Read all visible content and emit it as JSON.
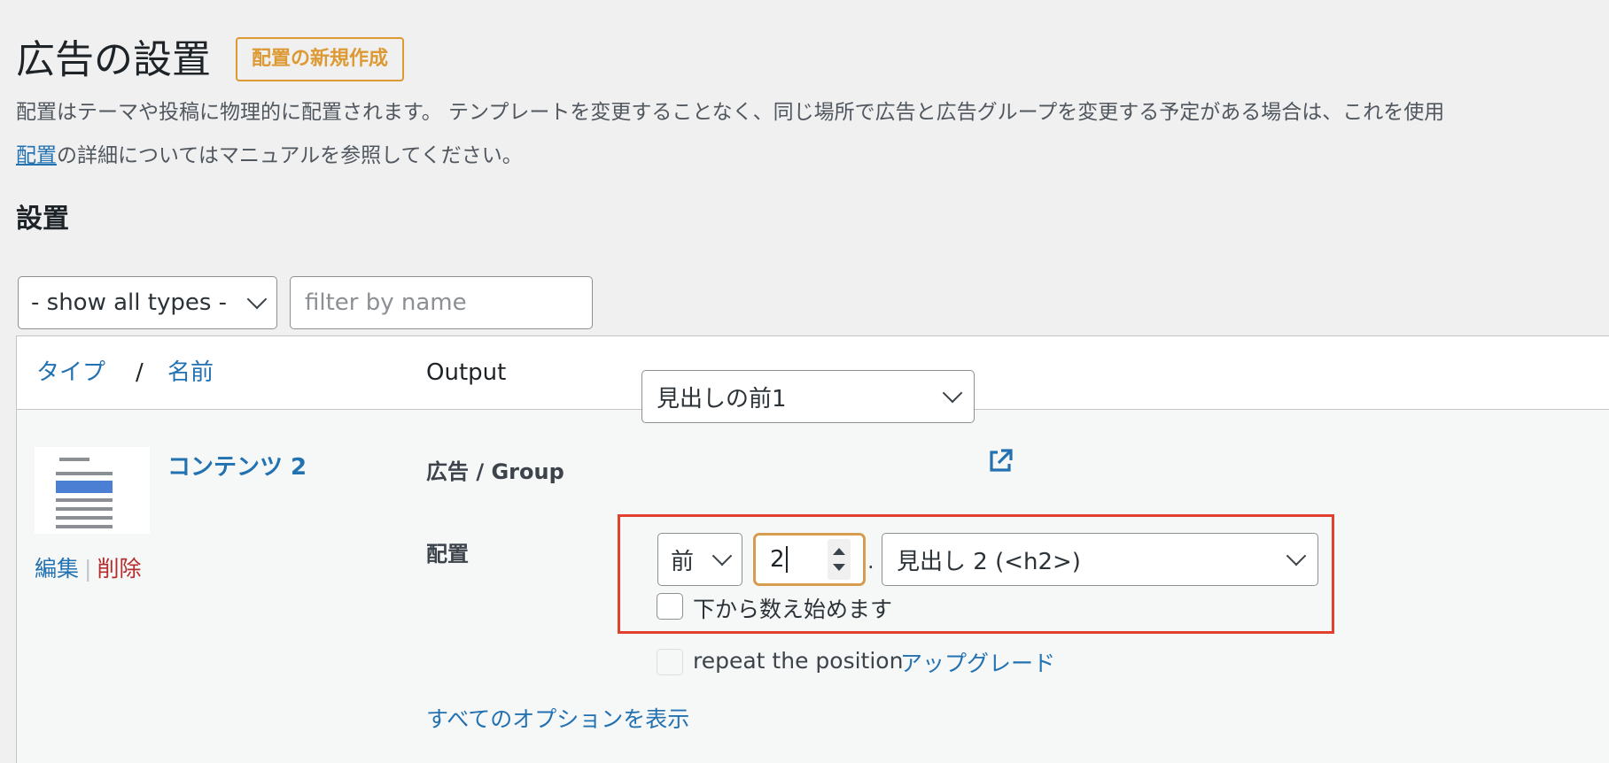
{
  "header": {
    "title": "広告の設置",
    "new_button": "配置の新規作成"
  },
  "description": {
    "line1": "配置はテーマや投稿に物理的に配置されます。 テンプレートを変更することなく、同じ場所で広告と広告グループを変更する予定がある場合は、これを使用",
    "link": "配置",
    "line2_rest": "の詳細についてはマニュアルを参照してください。"
  },
  "section": {
    "title": "設置"
  },
  "filters": {
    "type_select": "- show all types -",
    "name_placeholder": "filter by name"
  },
  "table": {
    "headers": {
      "type": "タイプ",
      "separator": "/",
      "name": "名前",
      "output": "Output"
    },
    "row": {
      "title": "コンテンツ 2",
      "actions": {
        "edit": "編集",
        "separator": "|",
        "delete": "削除"
      },
      "ad_label": "広告 / Group",
      "ad_value": "見出しの前1",
      "position_label": "配置",
      "position_select": "前",
      "index_value": "2",
      "index_separator": ".",
      "tag_select": "見出し 2 (<h2>)",
      "count_from_bottom": {
        "label": "下から数え始めます",
        "checked": false
      },
      "repeat_position": {
        "label": "repeat the position",
        "checked": false,
        "disabled": true
      },
      "upgrade_link": "アップグレード",
      "show_all_options": "すべてのオプションを表示"
    }
  },
  "colors": {
    "accent": "#2271b1",
    "new_button": "#dd9933",
    "delete": "#b32d2e",
    "highlight_border": "#e2402e",
    "focused_input_border": "#d69c4f"
  },
  "icons": [
    "chevron-down-icon",
    "external-link-icon",
    "placement-thumbnail-icon",
    "spinner-up-icon",
    "spinner-down-icon"
  ]
}
